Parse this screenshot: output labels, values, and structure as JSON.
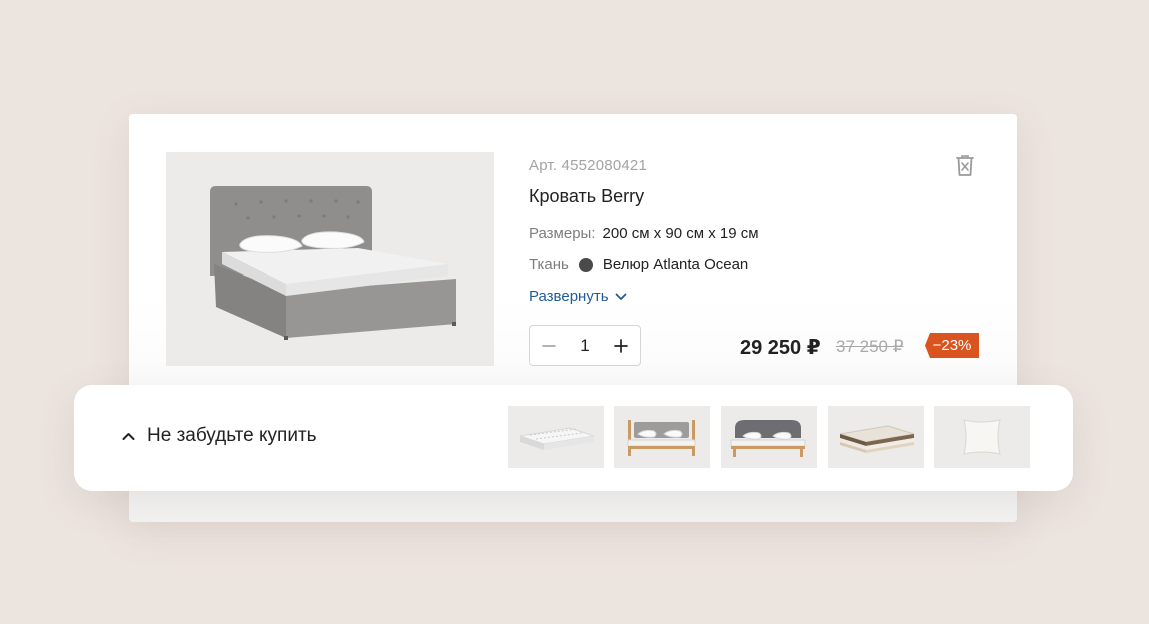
{
  "product": {
    "article": "Арт. 4552080421",
    "title": "Кровать Berry",
    "size_label": "Размеры:",
    "size_value": "200 см х 90 см х 19 см",
    "fabric_label": "Ткань",
    "fabric_value": "Велюр Atlanta Ocean",
    "fabric_color": "#4a4a4a",
    "expand_label": "Развернуть",
    "quantity": "1",
    "price": "29 250 ₽",
    "old_price": "37 250 ₽",
    "discount": "−23%",
    "discount_color": "#d9541f",
    "link_color": "#1f5c96"
  },
  "recommendations": {
    "title": "Не забудьте купить",
    "items": [
      {
        "icon": "mattress-thumb"
      },
      {
        "icon": "wooden-bed-thumb"
      },
      {
        "icon": "wooden-bed-gray-headboard-thumb"
      },
      {
        "icon": "mattress-layers-thumb"
      },
      {
        "icon": "pillow-thumb"
      }
    ]
  }
}
